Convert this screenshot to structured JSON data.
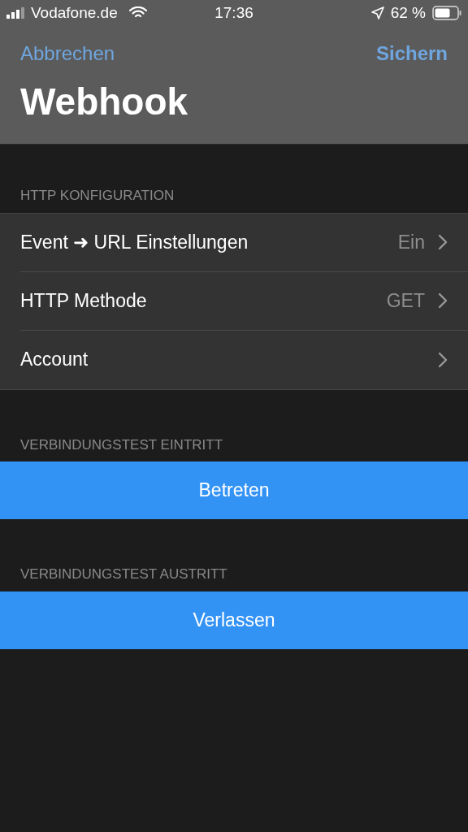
{
  "status_bar": {
    "carrier": "Vodafone.de",
    "time": "17:36",
    "battery": "62 %"
  },
  "nav": {
    "cancel": "Abbrechen",
    "save": "Sichern",
    "title": "Webhook"
  },
  "sections": [
    {
      "header": "HTTP KONFIGURATION",
      "kind": "list",
      "rows": [
        {
          "label": "Event ➜ URL Einstellungen",
          "value": "Ein"
        },
        {
          "label": "HTTP Methode",
          "value": "GET"
        },
        {
          "label": "Account"
        }
      ]
    },
    {
      "header": "VERBINDUNGSTEST EINTRITT",
      "kind": "button",
      "button": "Betreten"
    },
    {
      "header": "VERBINDUNGSTEST AUSTRITT",
      "kind": "button",
      "button": "Verlassen"
    }
  ]
}
